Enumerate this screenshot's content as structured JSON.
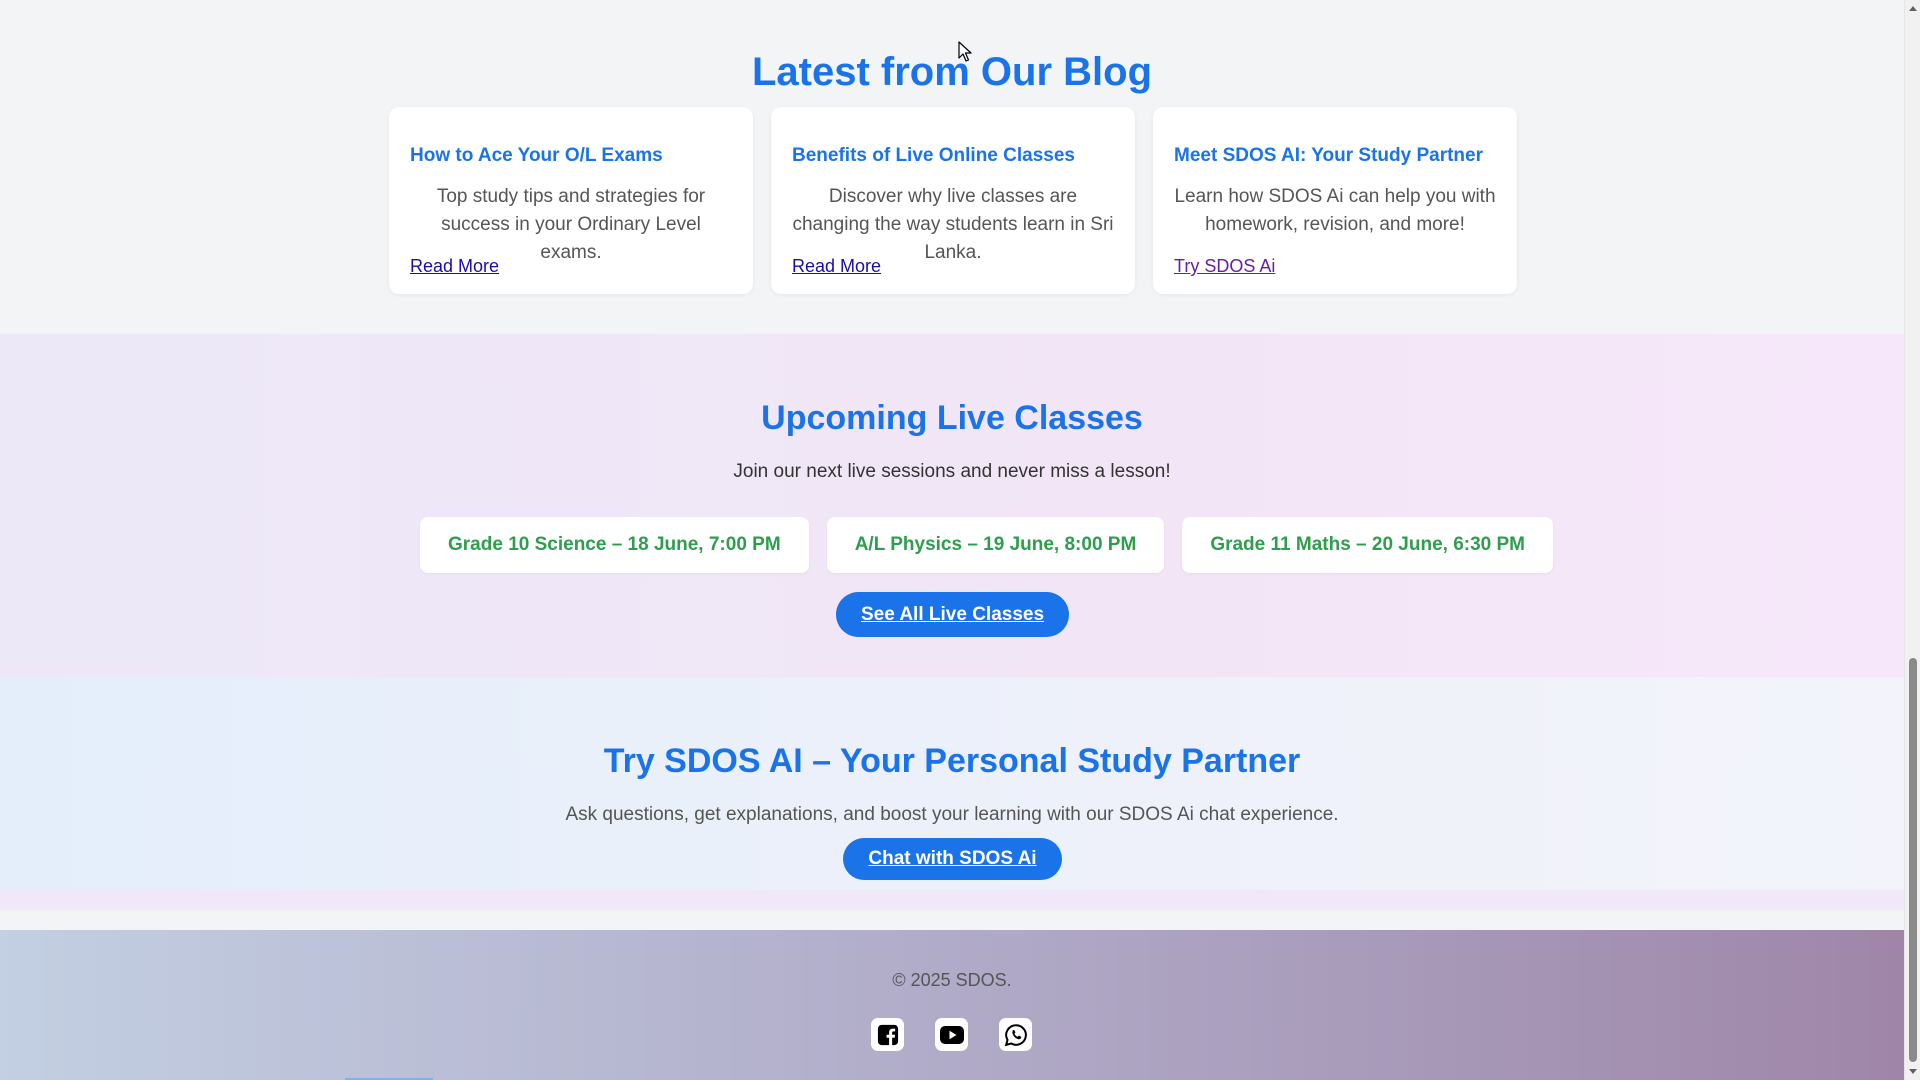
{
  "blog": {
    "title": "Latest from Our Blog",
    "cards": [
      {
        "title": "How to Ace Your O/L Exams",
        "text": "Top study tips and strategies for success in your Ordinary Level exams.",
        "link": "Read More"
      },
      {
        "title": "Benefits of Live Online Classes",
        "text": "Discover why live classes are changing the way students learn in Sri Lanka.",
        "link": "Read More"
      },
      {
        "title": "Meet SDOS AI: Your Study Partner",
        "text": "Learn how SDOS Ai can help you with homework, revision, and more!",
        "link": "Try SDOS Ai"
      }
    ]
  },
  "live": {
    "title": "Upcoming Live Classes",
    "subtitle": "Join our next live sessions and never miss a lesson!",
    "classes": [
      "Grade 10 Science – 18 June, 7:00 PM",
      "A/L Physics – 19 June, 8:00 PM",
      "Grade 11 Maths – 20 June, 6:30 PM"
    ],
    "button": "See All Live Classes"
  },
  "ai": {
    "title": "Try SDOS AI – Your Personal Study Partner",
    "subtitle": "Ask questions, get explanations, and boost your learning with our SDOS Ai chat experience.",
    "button": "Chat with SDOS Ai"
  },
  "footer": {
    "copyright": "© 2025 SDOS.",
    "socials": [
      "facebook-icon",
      "youtube-icon",
      "whatsapp-icon"
    ]
  },
  "colors": {
    "accent": "#1a73e8",
    "class_text": "#2e9e4d",
    "link": "#1a0dab",
    "link_visited": "#681da8"
  }
}
